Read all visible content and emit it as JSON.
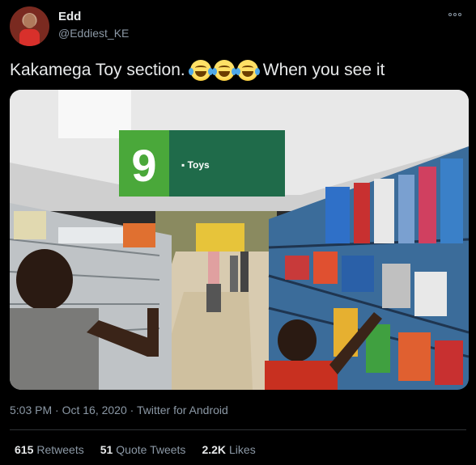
{
  "author": {
    "display_name": "Edd",
    "handle": "@Eddiest_KE",
    "avatar_icon": "user-avatar"
  },
  "tweet": {
    "text": "Kakamega Toy section.",
    "emoji_icon": "face-with-tears-of-joy-icon",
    "emoji_count": 3,
    "text_after": "When you see it"
  },
  "photo": {
    "sign_number": "9",
    "sign_label": "Toys",
    "sign_green": "#1f6b4a",
    "sign_number_bg": "#4aa83a"
  },
  "meta": {
    "time": "5:03 PM",
    "date": "Oct 16, 2020",
    "source": "Twitter for Android"
  },
  "stats": {
    "retweets_count": "615",
    "retweets_label": "Retweets",
    "quotes_count": "51",
    "quotes_label": "Quote Tweets",
    "likes_count": "2.2K",
    "likes_label": "Likes"
  },
  "colors": {
    "background": "#000000",
    "secondary_text": "#8b98a5",
    "primary_text": "#e7e9ea"
  }
}
